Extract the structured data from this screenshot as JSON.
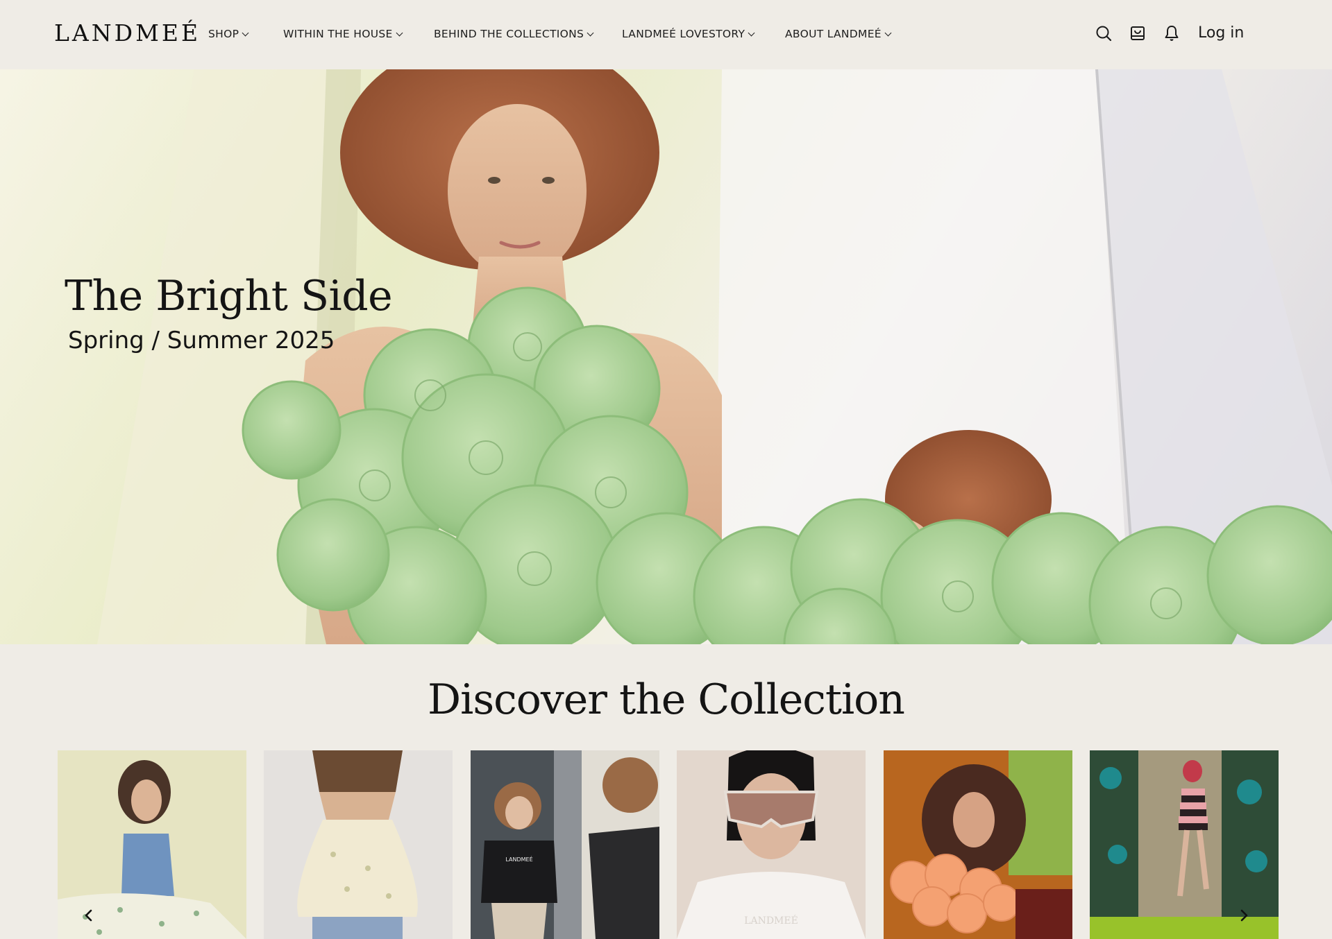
{
  "header": {
    "logo": "LANDMEÉ",
    "nav": [
      {
        "label": "SHOP",
        "icon": "chevron-down-icon"
      },
      {
        "label": "WITHIN THE HOUSE",
        "icon": "chevron-down-icon"
      },
      {
        "label": "BEHIND THE COLLECTIONS",
        "icon": "chevron-down-icon"
      },
      {
        "label": "LANDMEÉ LOVESTORY",
        "icon": "chevron-down-icon"
      },
      {
        "label": "ABOUT LANDMEÉ",
        "icon": "chevron-down-icon"
      }
    ],
    "icons": [
      "search-icon",
      "cart-icon",
      "bell-icon"
    ],
    "login": "Log in"
  },
  "hero": {
    "title": "The Bright Side",
    "subtitle": "Spring / Summer 2025"
  },
  "collection": {
    "title": "Discover the Collection",
    "cards": [
      {
        "name": "collection-card-blue-top"
      },
      {
        "name": "collection-card-satin-camisole"
      },
      {
        "name": "collection-card-black-sweater"
      },
      {
        "name": "collection-card-sunglasses"
      },
      {
        "name": "collection-card-orange-petals"
      },
      {
        "name": "collection-card-striped-dress"
      }
    ],
    "card_logo_text": "LANDMEÉ",
    "prev_icon": "chevron-left-icon",
    "next_icon": "chevron-right-icon"
  },
  "colors": {
    "background": "#efece6",
    "text": "#141414",
    "petal_green": "#9ec98b"
  }
}
